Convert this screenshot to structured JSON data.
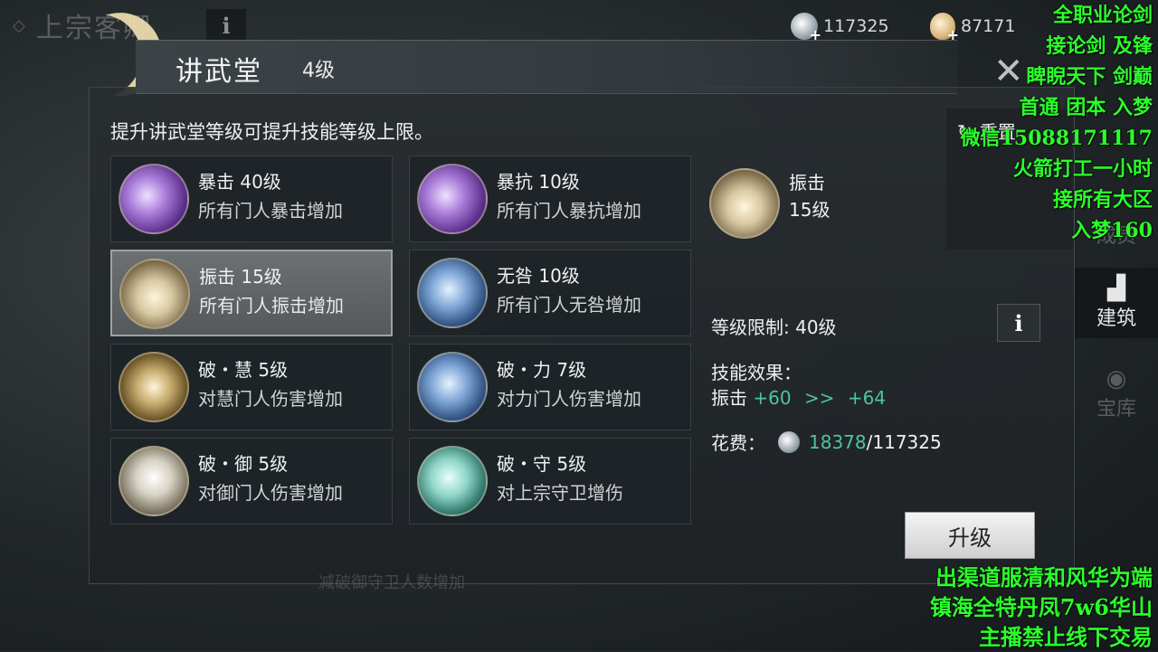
{
  "background": {
    "title": "上宗客卿",
    "info_icon": "i"
  },
  "currency": {
    "silver": {
      "icon": "silver-coin-icon",
      "value": "117325"
    },
    "gourd": {
      "icon": "gourd-icon",
      "value": "87171"
    }
  },
  "dialog": {
    "title": "讲武堂",
    "level": "4级",
    "description": "提升讲武堂等级可提升技能等级上限。",
    "close_icon": "✕"
  },
  "skills": [
    {
      "name": "暴击 40级",
      "effect": "所有门人暴击增加",
      "icon": "crit-icon",
      "color": "purple"
    },
    {
      "name": "暴抗 10级",
      "effect": "所有门人暴抗增加",
      "icon": "crit-resist-icon",
      "color": "purple"
    },
    {
      "name": "振击 15级",
      "effect": "所有门人振击增加",
      "icon": "shock-strike-icon",
      "color": "gold",
      "selected": true
    },
    {
      "name": "无咎 10级",
      "effect": "所有门人无咎增加",
      "icon": "blameless-icon",
      "color": "blue"
    },
    {
      "name": "破・慧 5级",
      "effect": "对慧门人伤害增加",
      "icon": "break-wisdom-icon",
      "color": "sepia"
    },
    {
      "name": "破・力 7级",
      "effect": "对力门人伤害增加",
      "icon": "break-power-icon",
      "color": "blue"
    },
    {
      "name": "破・御 5级",
      "effect": "对御门人伤害增加",
      "icon": "break-defense-icon",
      "color": "silver"
    },
    {
      "name": "破・守 5级",
      "effect": "对上宗守卫增伤",
      "icon": "break-guard-icon",
      "color": "teal"
    }
  ],
  "detail": {
    "name": "振击",
    "level": "15级",
    "limit_label": "等级限制: 40级",
    "effect_label": "技能效果：",
    "effect_stat": "振击",
    "effect_from": "+60",
    "effect_arrow": ">>",
    "effect_to": "+64",
    "cost_label": "花费：",
    "cost_current": "18378",
    "cost_total": "/117325",
    "upgrade_label": "升级",
    "info_icon": "i"
  },
  "faded_text": "减破御守卫人数增加",
  "side_tabs": [
    {
      "label": "重置",
      "icon": "reset-icon"
    },
    {
      "label": "成员",
      "icon": "members-icon"
    },
    {
      "label": "建筑",
      "icon": "building-icon",
      "active": true
    },
    {
      "label": "宝库",
      "icon": "treasury-icon"
    }
  ],
  "overlay_top": [
    "全职业论剑",
    "接论剑 及锋",
    "睥睨天下  剑巅",
    "首通 团本 入梦",
    "微信15088171117",
    "火箭打工一小时",
    "接所有大区",
    "入梦160"
  ],
  "overlay_bottom": [
    "出渠道服清和风华为端",
    "镇海全特丹凤7w6华山",
    "主播禁止线下交易"
  ]
}
